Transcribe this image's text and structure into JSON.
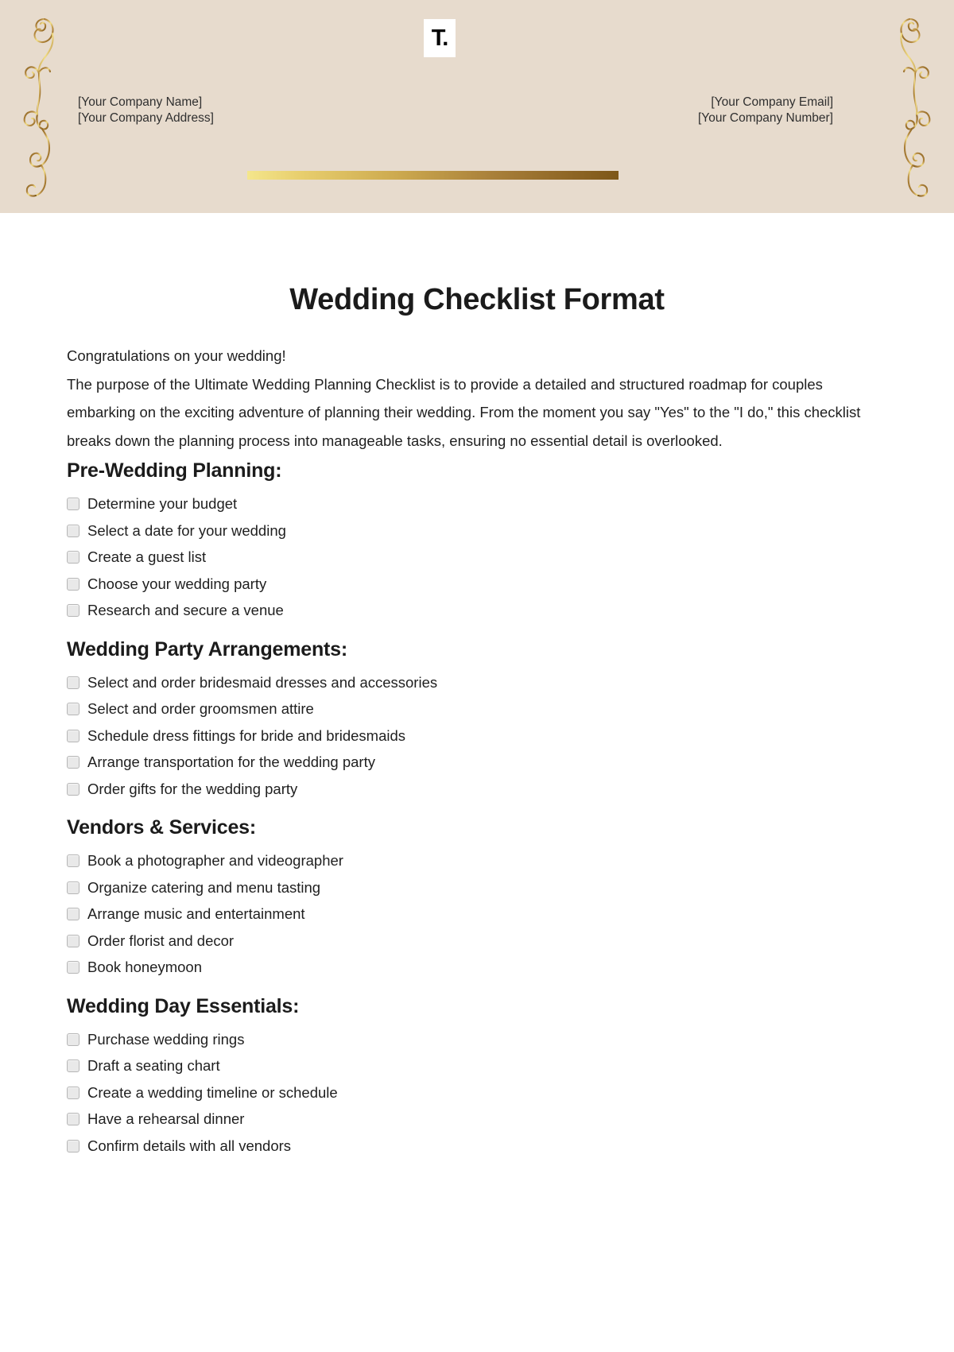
{
  "header": {
    "logo": {
      "icon": "templatenet-t-logo",
      "text": "T."
    },
    "company_name": "[Your Company Name]",
    "company_address": "[Your Company Address]",
    "company_email": "[Your Company Email]",
    "company_number": "[Your Company Number]",
    "ornament_left_icon": "flourish-scroll-ornament-left",
    "ornament_right_icon": "flourish-scroll-ornament-right",
    "divider_icon": "gold-gradient-rule",
    "colors": {
      "band_background": "#e7dbcd",
      "gold_light": "#f4e68c",
      "gold_dark": "#7d5718",
      "ornament_gold": "#a8823c"
    }
  },
  "document": {
    "title": "Wedding Checklist Format",
    "intro_greeting": "Congratulations on your wedding!",
    "intro_body": "The purpose of the Ultimate Wedding Planning Checklist is to provide a detailed and structured roadmap for couples embarking on the exciting adventure of planning their wedding. From the moment you say \"Yes\" to the \"I do,\" this checklist breaks down the planning process into manageable tasks, ensuring no essential detail is overlooked.",
    "sections": [
      {
        "heading": "Pre-Wedding Planning:",
        "items": [
          {
            "label": "Determine your budget",
            "checked": false
          },
          {
            "label": "Select a date for your wedding",
            "checked": false
          },
          {
            "label": "Create a guest list",
            "checked": false
          },
          {
            "label": "Choose your wedding party",
            "checked": false
          },
          {
            "label": "Research and secure a venue",
            "checked": false
          }
        ]
      },
      {
        "heading": "Wedding Party Arrangements:",
        "items": [
          {
            "label": "Select and order bridesmaid dresses and accessories",
            "checked": false
          },
          {
            "label": "Select and order groomsmen attire",
            "checked": false
          },
          {
            "label": "Schedule dress fittings for bride and bridesmaids",
            "checked": false
          },
          {
            "label": "Arrange transportation for the wedding party",
            "checked": false
          },
          {
            "label": "Order gifts for the wedding party",
            "checked": false
          }
        ]
      },
      {
        "heading": "Vendors & Services:",
        "items": [
          {
            "label": "Book a photographer and videographer",
            "checked": false
          },
          {
            "label": "Organize catering and menu tasting",
            "checked": false
          },
          {
            "label": "Arrange music and entertainment",
            "checked": false
          },
          {
            "label": "Order florist and decor",
            "checked": false
          },
          {
            "label": "Book honeymoon",
            "checked": false
          }
        ]
      },
      {
        "heading": "Wedding Day Essentials:",
        "items": [
          {
            "label": "Purchase wedding rings",
            "checked": false
          },
          {
            "label": "Draft a seating chart",
            "checked": false
          },
          {
            "label": "Create a wedding timeline or schedule",
            "checked": false
          },
          {
            "label": "Have a rehearsal dinner",
            "checked": false
          },
          {
            "label": "Confirm details with all vendors",
            "checked": false
          }
        ]
      }
    ]
  }
}
